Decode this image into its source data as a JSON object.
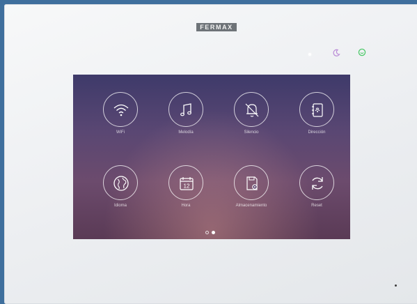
{
  "device": {
    "brand": "FERMAX",
    "indicators": [
      {
        "name": "power",
        "icon": "dot-led-icon",
        "color": "#ffffff"
      },
      {
        "name": "do-not-disturb",
        "icon": "moon-icon",
        "color": "#b98ad6"
      },
      {
        "name": "status",
        "icon": "smile-icon",
        "color": "#4fc96b"
      }
    ]
  },
  "screen": {
    "menu": [
      {
        "label": "WiFi",
        "icon": "wifi-icon"
      },
      {
        "label": "Melodía",
        "icon": "music-note-icon"
      },
      {
        "label": "Silencio",
        "icon": "bell-off-icon"
      },
      {
        "label": "Dirección",
        "icon": "address-book-icon"
      },
      {
        "label": "Idioma",
        "icon": "globe-icon"
      },
      {
        "label": "Hora",
        "icon": "calendar-icon"
      },
      {
        "label": "Almacenamiento",
        "icon": "storage-settings-icon"
      },
      {
        "label": "Reset",
        "icon": "refresh-icon"
      }
    ],
    "pagination": {
      "total": 2,
      "current": 2
    }
  }
}
